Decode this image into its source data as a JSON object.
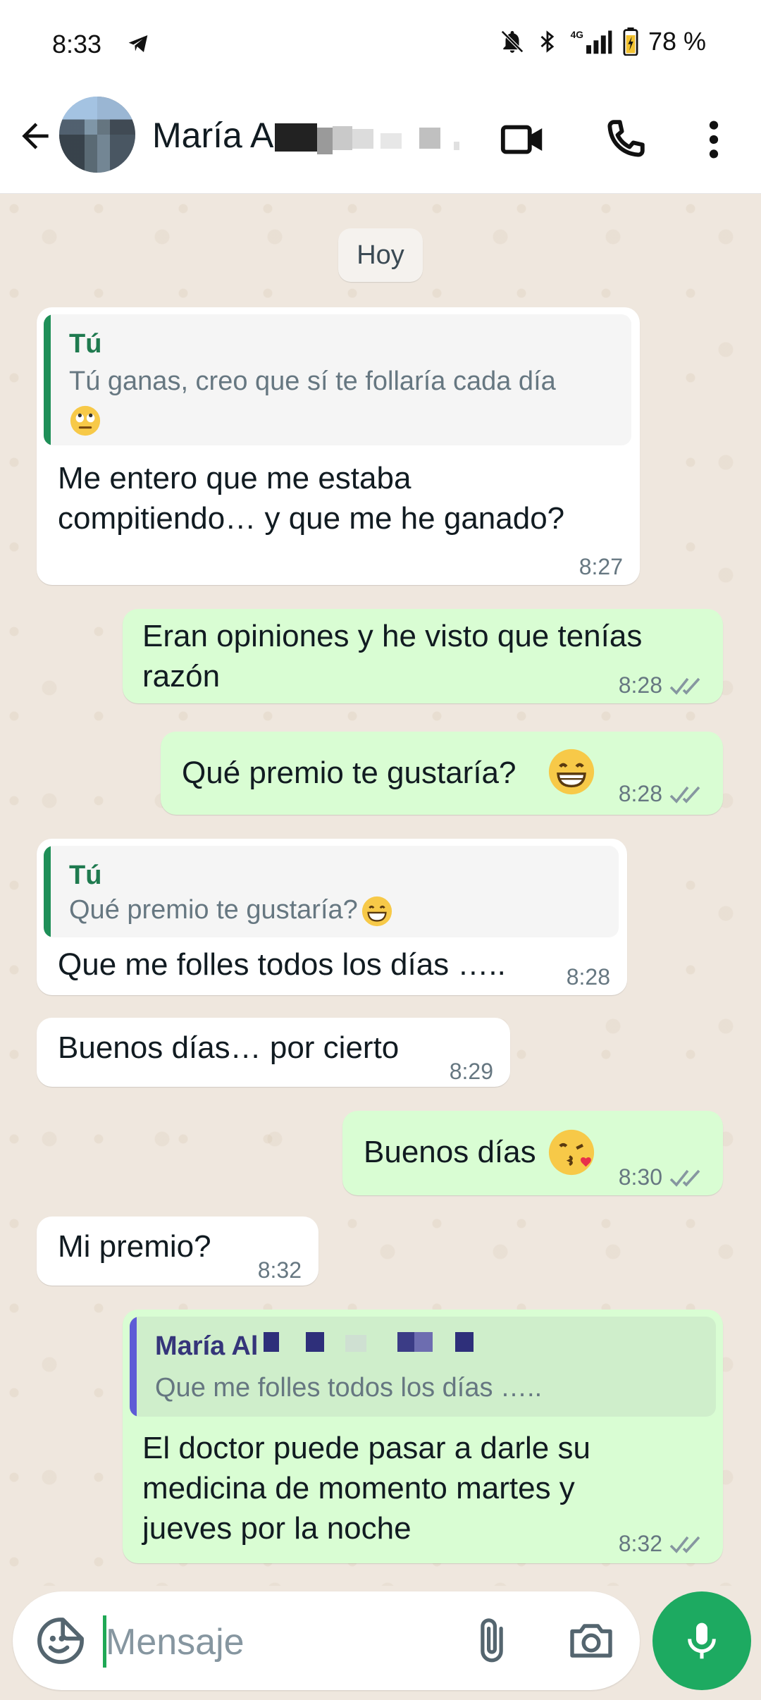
{
  "status_bar": {
    "time": "8:33",
    "battery": "78 %",
    "network": "4G"
  },
  "header": {
    "contact_name": "María A",
    "icons": [
      "back-arrow-icon",
      "video-call-icon",
      "phone-icon",
      "more-vert-icon"
    ]
  },
  "chat": {
    "date_chip": "Hoy",
    "messages": [
      {
        "direction": "in",
        "quote_author": "Tú",
        "quote_text": "Tú ganas, creo que sí te follaría cada día",
        "text_line1": "Me entero que me estaba",
        "text_line2": "compitiendo… y que me he ganado?",
        "time": "8:27"
      },
      {
        "direction": "out",
        "text_line1": "Eran opiniones y he visto que tenías",
        "text_line2": "razón",
        "time": "8:28"
      },
      {
        "direction": "out",
        "text": "Qué premio te gustaría?",
        "time": "8:28"
      },
      {
        "direction": "in",
        "quote_author": "Tú",
        "quote_text": "Qué premio te gustaría?",
        "text": "Que me folles todos los días …..",
        "time": "8:28"
      },
      {
        "direction": "in",
        "text": "Buenos días… por cierto",
        "time": "8:29"
      },
      {
        "direction": "out",
        "text": "Buenos días",
        "time": "8:30"
      },
      {
        "direction": "in",
        "text": "Mi premio?",
        "time": "8:32"
      },
      {
        "direction": "out",
        "quote_author": "María Al",
        "quote_text": "Que me folles todos los días …..",
        "text_line1": "El doctor puede pasar a darle su",
        "text_line2": "medicina de momento martes y",
        "text_line3": "jueves por la noche",
        "time": "8:32"
      }
    ]
  },
  "composer": {
    "placeholder": "Mensaje"
  },
  "colors": {
    "outgoing_bubble": "#d9fdd3",
    "incoming_bubble": "#ffffff",
    "accent_green": "#1daa61",
    "quote_you": "#06cf9c",
    "quote_contact": "#5e5bd6",
    "chat_background": "#efe7de"
  }
}
